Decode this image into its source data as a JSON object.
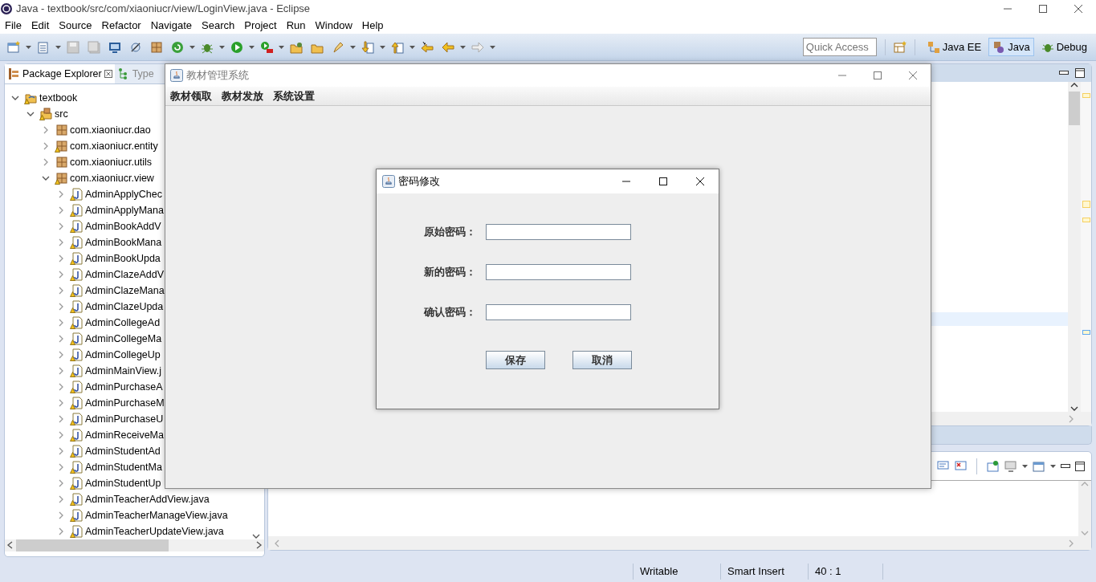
{
  "window": {
    "title": "Java - textbook/src/com/xiaoniucr/view/LoginView.java - Eclipse"
  },
  "menu": [
    "File",
    "Edit",
    "Source",
    "Refactor",
    "Navigate",
    "Search",
    "Project",
    "Run",
    "Window",
    "Help"
  ],
  "quick_access": {
    "placeholder": "Quick Access"
  },
  "perspectives": [
    {
      "label": "Java EE",
      "selected": false
    },
    {
      "label": "Java",
      "selected": true
    },
    {
      "label": "Debug",
      "selected": false
    }
  ],
  "package_explorer": {
    "tabs": [
      {
        "label": "Package Explorer",
        "selected": true
      },
      {
        "label": "Type",
        "selected": false
      }
    ],
    "tree": [
      {
        "label": "textbook",
        "kind": "project",
        "warning": true,
        "expanded": true,
        "children": [
          {
            "label": "src",
            "kind": "folder",
            "warning": true,
            "expanded": true,
            "children": [
              {
                "label": "com.xiaoniucr.dao",
                "kind": "package",
                "warning": false,
                "expanded": false
              },
              {
                "label": "com.xiaoniucr.entity",
                "kind": "package",
                "warning": true,
                "expanded": false
              },
              {
                "label": "com.xiaoniucr.utils",
                "kind": "package",
                "warning": false,
                "expanded": false
              },
              {
                "label": "com.xiaoniucr.view",
                "kind": "package",
                "warning": true,
                "expanded": true,
                "children": [
                  {
                    "label": "AdminApplyChec",
                    "kind": "file",
                    "warning": true,
                    "expanded": false
                  },
                  {
                    "label": "AdminApplyMana",
                    "kind": "file",
                    "warning": true,
                    "expanded": false
                  },
                  {
                    "label": "AdminBookAddV",
                    "kind": "file",
                    "warning": true,
                    "expanded": false
                  },
                  {
                    "label": "AdminBookMana",
                    "kind": "file",
                    "warning": true,
                    "expanded": false
                  },
                  {
                    "label": "AdminBookUpda",
                    "kind": "file",
                    "warning": true,
                    "expanded": false
                  },
                  {
                    "label": "AdminClazeAddV",
                    "kind": "file",
                    "warning": true,
                    "expanded": false
                  },
                  {
                    "label": "AdminClazeMana",
                    "kind": "file",
                    "warning": true,
                    "expanded": false
                  },
                  {
                    "label": "AdminClazeUpda",
                    "kind": "file",
                    "warning": true,
                    "expanded": false
                  },
                  {
                    "label": "AdminCollegeAd",
                    "kind": "file",
                    "warning": true,
                    "expanded": false
                  },
                  {
                    "label": "AdminCollegeMa",
                    "kind": "file",
                    "warning": true,
                    "expanded": false
                  },
                  {
                    "label": "AdminCollegeUp",
                    "kind": "file",
                    "warning": true,
                    "expanded": false
                  },
                  {
                    "label": "AdminMainView.j",
                    "kind": "file",
                    "warning": true,
                    "expanded": false
                  },
                  {
                    "label": "AdminPurchaseA",
                    "kind": "file",
                    "warning": true,
                    "expanded": false
                  },
                  {
                    "label": "AdminPurchaseM",
                    "kind": "file",
                    "warning": true,
                    "expanded": false
                  },
                  {
                    "label": "AdminPurchaseU",
                    "kind": "file",
                    "warning": true,
                    "expanded": false
                  },
                  {
                    "label": "AdminReceiveMa",
                    "kind": "file",
                    "warning": true,
                    "expanded": false
                  },
                  {
                    "label": "AdminStudentAd",
                    "kind": "file",
                    "warning": true,
                    "expanded": false
                  },
                  {
                    "label": "AdminStudentMa",
                    "kind": "file",
                    "warning": true,
                    "expanded": false
                  },
                  {
                    "label": "AdminStudentUp",
                    "kind": "file",
                    "warning": true,
                    "expanded": false
                  },
                  {
                    "label": "AdminTeacherAddView.java",
                    "kind": "file",
                    "warning": true,
                    "expanded": false
                  },
                  {
                    "label": "AdminTeacherManageView.java",
                    "kind": "file",
                    "warning": true,
                    "expanded": false
                  },
                  {
                    "label": "AdminTeacherUpdateView.java",
                    "kind": "file",
                    "warning": true,
                    "expanded": false
                  }
                ]
              }
            ]
          }
        ]
      }
    ]
  },
  "app_window": {
    "title": "教材管理系统",
    "menu": [
      "教材领取",
      "教材发放",
      "系统设置"
    ]
  },
  "dialog": {
    "title": "密码修改",
    "fields": [
      {
        "label": "原始密码："
      },
      {
        "label": "新的密码："
      },
      {
        "label": "确认密码："
      }
    ],
    "buttons": [
      "保存",
      "取消"
    ]
  },
  "status_bar": [
    "Writable",
    "Smart Insert",
    "40 : 1"
  ]
}
